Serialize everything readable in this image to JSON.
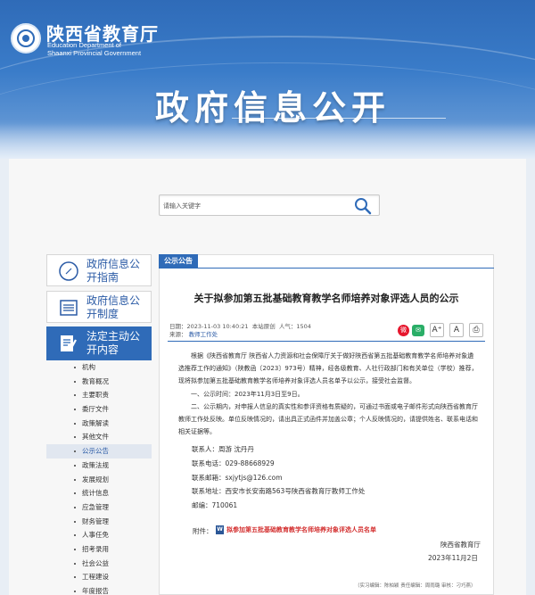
{
  "header": {
    "site_name_cn": "陕西省教育厅",
    "site_name_en_line1": "Education Department of",
    "site_name_en_line2": "Shaanxi Provincial Government",
    "page_title": "政府信息公开"
  },
  "search": {
    "placeholder": "请输入关键字"
  },
  "sidebar": {
    "cards": [
      {
        "label": "政府信息公开指南",
        "icon": "compass-icon"
      },
      {
        "label": "政府信息公开制度",
        "icon": "list-icon"
      },
      {
        "label": "法定主动公开内容",
        "icon": "document-pen-icon"
      }
    ],
    "items": [
      "机构",
      "教育概况",
      "主要职责",
      "委厅文件",
      "政策解读",
      "其他文件",
      "公示公告",
      "政策法规",
      "发展规划",
      "统计信息",
      "应急管理",
      "财务管理",
      "人事任免",
      "招考录用",
      "社会公益",
      "工程建设",
      "年度报告"
    ],
    "active_item": "公示公告"
  },
  "article": {
    "section_tag": "公示公告",
    "title": "关于拟参加第五批基础教育教学名师培养对象评选人员的公示",
    "meta_date": "日期：2023-11-03 10:40:21",
    "meta_source_label": "本站原创",
    "meta_views": "人气：1504",
    "meta_from_label": "来源：",
    "meta_from_value": "教师工作处",
    "tool_labels": {
      "font_large": "A⁺",
      "font_normal": "A",
      "print": "⎙"
    },
    "para1": "根据《陕西省教育厅 陕西省人力资源和社会保障厅关于做好陕西省第五批基础教育教学名师培养对象遴选推荐工作的通知》（陕教函〔2023〕973号）精神，经各级教育、人社行政部门和有关单位（学校）推荐，现将拟参加第五批基础教育教学名师培养对象评选人员名单予以公示，接受社会监督。",
    "para2": "一、公示时间：2023年11月3日至9日。",
    "para3": "二、公示期内，对申报人信息的真实性和参评资格有质疑的，可通过书面或电子邮件形式向陕西省教育厅教师工作处反映。单位反映情况的，请出具正式函件并加盖公章；个人反映情况的，请提供姓名、联系电话和相关证据等。",
    "contact_person": "联系人：周游 沈丹丹",
    "contact_phone": "联系电话：029-88668929",
    "contact_email": "联系邮箱：sxjytjs@126.com",
    "contact_address": "联系地址：西安市长安南路563号陕西省教育厅教师工作处",
    "postcode": "邮编：710061",
    "attachment_label": "附件：",
    "attachment_name": "拟参加第五批基础教育教学名师培养对象评选人员名单",
    "signature": "陕西省教育厅",
    "sign_date": "2023年11月2日",
    "editors": "（实习编辑：陈柏颖  责任编辑：周雨璐  审核：刁巧燕）"
  }
}
